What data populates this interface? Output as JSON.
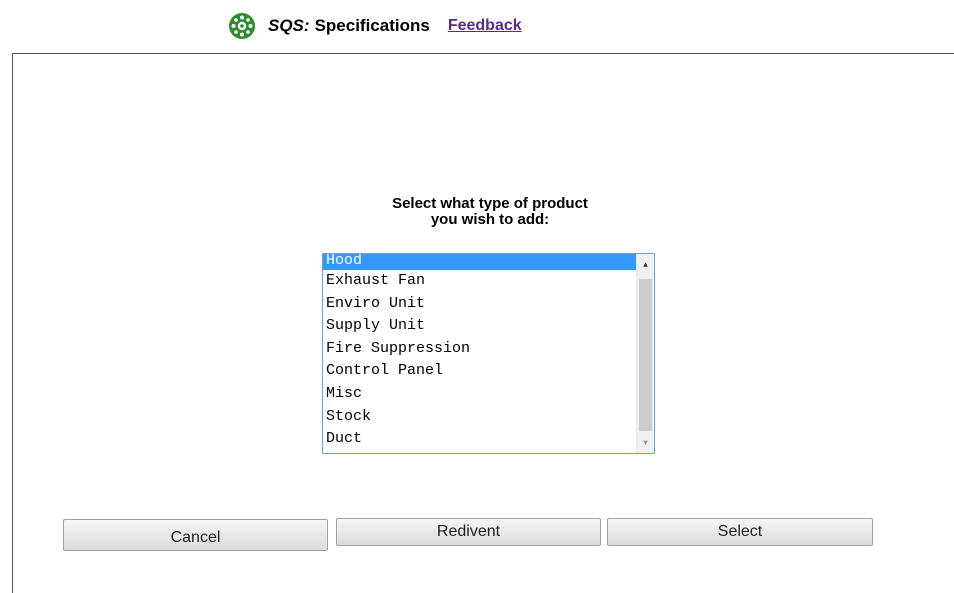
{
  "header": {
    "app_name": "SQS:",
    "title": "Specifications",
    "feedback_link": "Feedback",
    "logo_icon": "green-gear-logo-icon",
    "logo_color": "#2e8b2e"
  },
  "prompt": {
    "line1": "Select what type of product",
    "line2": "you wish to add:"
  },
  "product_list": {
    "selected": "Hood",
    "items": [
      "Hood",
      "Exhaust Fan",
      "Enviro Unit",
      "Supply Unit",
      "Fire Suppression",
      "Control Panel",
      "Misc",
      "Stock",
      "Duct"
    ]
  },
  "buttons": {
    "cancel": "Cancel",
    "redivent": "Redivent",
    "select": "Select"
  },
  "colors": {
    "selection": "#3399ff",
    "feedback_link": "#5b2a86",
    "listbox_border": "#7a9cd3"
  }
}
